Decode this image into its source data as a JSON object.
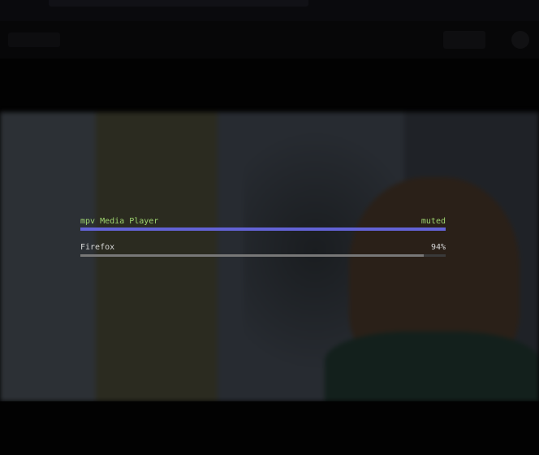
{
  "colors": {
    "active_text": "#9ed46f",
    "active_bar": "#6363d6",
    "inactive_text": "#d8d8d8",
    "inactive_bar": "#787878"
  },
  "mixer": {
    "items": [
      {
        "name": "mpv Media Player",
        "value": "muted",
        "level": 1.0,
        "active": true
      },
      {
        "name": "Firefox",
        "value": "94%",
        "level": 0.94,
        "active": false
      }
    ]
  }
}
